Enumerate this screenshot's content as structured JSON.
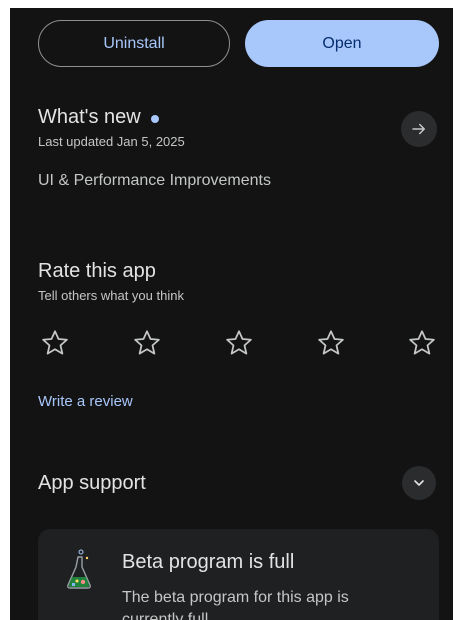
{
  "actions": {
    "uninstall_label": "Uninstall",
    "open_label": "Open"
  },
  "whats_new": {
    "title": "What's new",
    "last_updated": "Last updated Jan 5, 2025",
    "body": "UI & Performance Improvements",
    "arrow_icon": "arrow-right-icon"
  },
  "rate": {
    "title": "Rate this app",
    "subtitle": "Tell others what you think",
    "star_count": 5,
    "current_rating": 0,
    "write_review_label": "Write a review"
  },
  "support": {
    "title": "App support",
    "expand_icon": "chevron-down-icon"
  },
  "beta": {
    "title": "Beta program is full",
    "body": "The beta program for this app is currently full."
  },
  "colors": {
    "background": "#131314",
    "accent": "#a8c7fa",
    "on_accent": "#062e6f",
    "card": "#1f2022"
  }
}
